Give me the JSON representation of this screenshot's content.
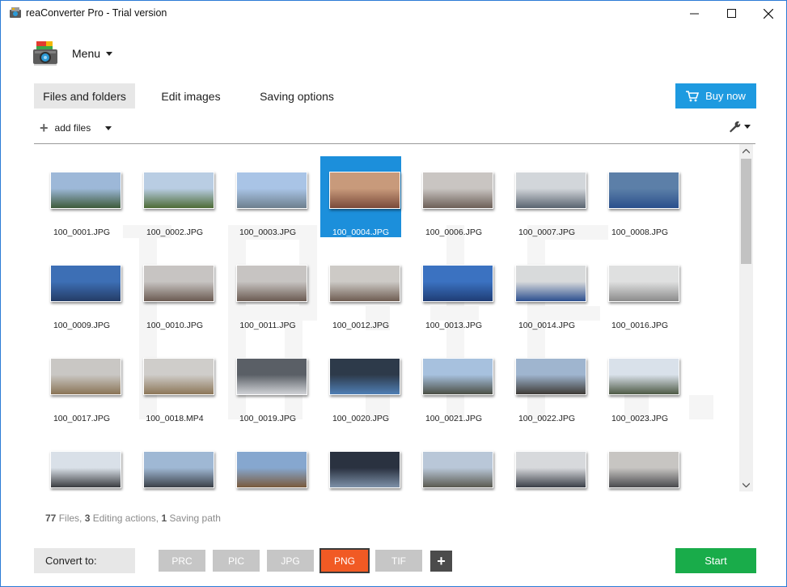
{
  "window": {
    "title": "reaConverter Pro - Trial version",
    "minimize_glyph": "—",
    "maximize_glyph": "☐",
    "close_glyph": "✕"
  },
  "menu": {
    "label": "Menu"
  },
  "tabs": [
    {
      "label": "Files and folders",
      "active": true
    },
    {
      "label": "Edit images",
      "active": false
    },
    {
      "label": "Saving options",
      "active": false
    }
  ],
  "buy_now": {
    "label": "Buy now",
    "color": "#1e9ae0"
  },
  "toolbar": {
    "add_files_label": "add files"
  },
  "files": [
    {
      "name": "100_0001.JPG",
      "colors": [
        "#9db8d8",
        "#3d5a3a"
      ]
    },
    {
      "name": "100_0002.JPG",
      "colors": [
        "#b9cde3",
        "#4d6b35"
      ]
    },
    {
      "name": "100_0003.JPG",
      "colors": [
        "#a9c4e6",
        "#6d7f8d"
      ]
    },
    {
      "name": "100_0004.JPG",
      "colors": [
        "#c89a7b",
        "#7a4a3a"
      ],
      "selected": true
    },
    {
      "name": "100_0006.JPG",
      "colors": [
        "#c9c5c2",
        "#6c5f57"
      ]
    },
    {
      "name": "100_0007.JPG",
      "colors": [
        "#d2d6da",
        "#5a6470"
      ]
    },
    {
      "name": "100_0008.JPG",
      "colors": [
        "#5c7fa8",
        "#2a4f8c"
      ]
    },
    {
      "name": "100_0009.JPG",
      "colors": [
        "#3d6fb5",
        "#243c66"
      ]
    },
    {
      "name": "100_0010.JPG",
      "colors": [
        "#c7c4c2",
        "#6b5b52"
      ]
    },
    {
      "name": "100_0011.JPG",
      "colors": [
        "#c7c4c2",
        "#6b5b52"
      ]
    },
    {
      "name": "100_0012.JPG",
      "colors": [
        "#cdcac6",
        "#6e5d52"
      ]
    },
    {
      "name": "100_0013.JPG",
      "colors": [
        "#3b72c1",
        "#1f3d75"
      ]
    },
    {
      "name": "100_0014.JPG",
      "colors": [
        "#d8dadb",
        "#2c4f8f"
      ]
    },
    {
      "name": "100_0016.JPG",
      "colors": [
        "#dfe0e0",
        "#8b8b8b"
      ]
    },
    {
      "name": "100_0017.JPG",
      "colors": [
        "#c9c7c4",
        "#8a7456"
      ]
    },
    {
      "name": "100_0018.MP4",
      "colors": [
        "#cfcdca",
        "#8c7658"
      ]
    },
    {
      "name": "100_0019.JPG",
      "colors": [
        "#5a5f66",
        "#d0d2d6"
      ]
    },
    {
      "name": "100_0020.JPG",
      "colors": [
        "#2d3a4a",
        "#4f7fb5"
      ]
    },
    {
      "name": "100_0021.JPG",
      "colors": [
        "#a7c1de",
        "#4b4f45"
      ]
    },
    {
      "name": "100_0022.JPG",
      "colors": [
        "#9fb5cf",
        "#3e3b36"
      ]
    },
    {
      "name": "100_0023.JPG",
      "colors": [
        "#d9e1ea",
        "#4e5a45"
      ]
    },
    {
      "name": "",
      "colors": [
        "#d9e0e8",
        "#3a3c40"
      ]
    },
    {
      "name": "",
      "colors": [
        "#9fb8d4",
        "#3c4148"
      ]
    },
    {
      "name": "",
      "colors": [
        "#86a7cf",
        "#7a5a3c"
      ]
    },
    {
      "name": "",
      "colors": [
        "#2a3240",
        "#7d90a8"
      ]
    },
    {
      "name": "",
      "colors": [
        "#b9c7d8",
        "#5a5a50"
      ]
    },
    {
      "name": "",
      "colors": [
        "#d7d9dc",
        "#3a3f48"
      ]
    },
    {
      "name": "",
      "colors": [
        "#c7c5c2",
        "#4a4a4e"
      ]
    }
  ],
  "status": {
    "files_count": "77",
    "files_label": "Files,",
    "editing_count": "3",
    "editing_label": "Editing actions,",
    "saving_count": "1",
    "saving_label": "Saving path"
  },
  "convert": {
    "label": "Convert to:",
    "formats": [
      {
        "label": "PRC",
        "active": false
      },
      {
        "label": "PIC",
        "active": false
      },
      {
        "label": "JPG",
        "active": false
      },
      {
        "label": "PNG",
        "active": true
      },
      {
        "label": "TIF",
        "active": false
      }
    ],
    "add_label": "+",
    "active_color": "#f15a24"
  },
  "start": {
    "label": "Start",
    "color": "#19ac4a"
  }
}
